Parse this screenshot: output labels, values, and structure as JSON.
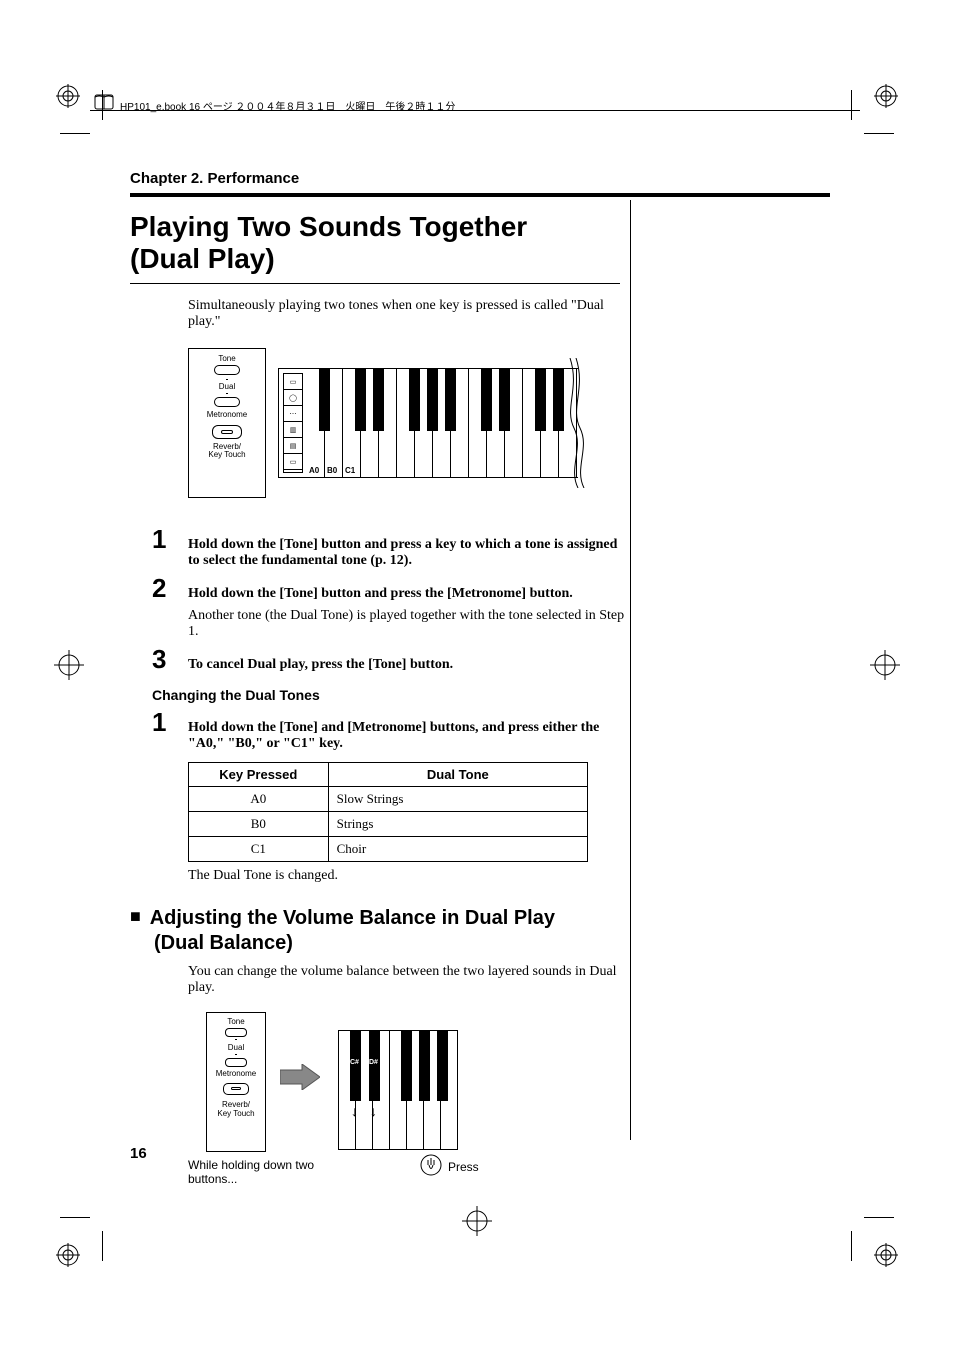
{
  "header_text": "HP101_e.book 16 ページ ２００４年８月３１日　火曜日　午後２時１１分",
  "chapter": "Chapter 2. Performance",
  "title_line1": "Playing Two Sounds Together",
  "title_line2": "(Dual Play)",
  "intro": "Simultaneously playing two tones when one key is pressed is called \"Dual play.\"",
  "panel": {
    "tone": "Tone",
    "dual": "Dual",
    "metronome": "Metronome",
    "reverb": "Reverb/\nKey Touch"
  },
  "kbd_labels": {
    "a0": "A0",
    "b0": "B0",
    "c1": "C1"
  },
  "steps": {
    "s1_num": "1",
    "s1": "Hold down the [Tone] button and press a key to which a tone is assigned to select the fundamental tone (p. 12).",
    "s2_num": "2",
    "s2": "Hold down the [Tone] button and press the [Metronome] button.",
    "s2b": "Another tone (the Dual Tone) is played together with the tone selected in Step 1.",
    "s3_num": "3",
    "s3": "To cancel Dual play, press the [Tone] button."
  },
  "subhead": "Changing the Dual Tones",
  "change": {
    "num": "1",
    "text": "Hold down the [Tone] and [Metronome] buttons, and press either the \"A0,\" \"B0,\" or \"C1\" key."
  },
  "table": {
    "h1": "Key Pressed",
    "h2": "Dual Tone",
    "rows": [
      {
        "k": "A0",
        "t": "Slow Strings"
      },
      {
        "k": "B0",
        "t": "Strings"
      },
      {
        "k": "C1",
        "t": "Choir"
      }
    ]
  },
  "after_table": "The Dual Tone is changed.",
  "h2_line1": "Adjusting the Volume Balance in Dual Play",
  "h2_line2": "(Dual Balance)",
  "h2_body": "You can change the volume balance between the two layered sounds in Dual play.",
  "fig2_caption1": "While holding down two buttons...",
  "fig2_caption2": "Press",
  "kbd2_labels": {
    "csharp": "C#",
    "dsharp": "D#"
  },
  "pagenum": "16"
}
